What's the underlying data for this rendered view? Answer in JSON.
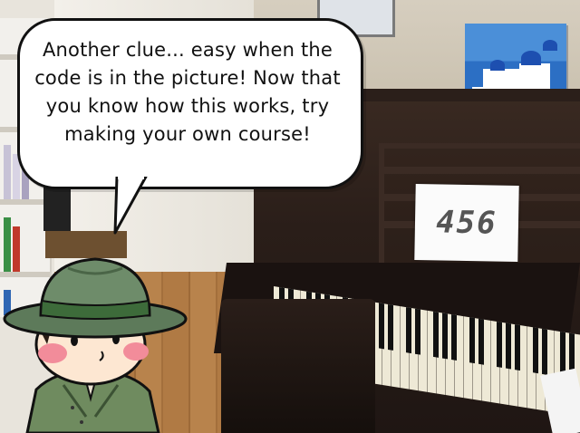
{
  "dialog": {
    "text": "Another clue... easy when the code is in the picture! Now that you know how this works, try making your own course!"
  },
  "scene": {
    "clue_code": "456"
  },
  "character": {
    "name": "detective-character"
  },
  "colors": {
    "bubble_fill": "#ffffff",
    "bubble_outline": "#111111",
    "hat": "#5d7a5a",
    "hat_band": "#3d6b3a",
    "coat": "#6f8b5f",
    "cheek": "#f28c9a"
  }
}
